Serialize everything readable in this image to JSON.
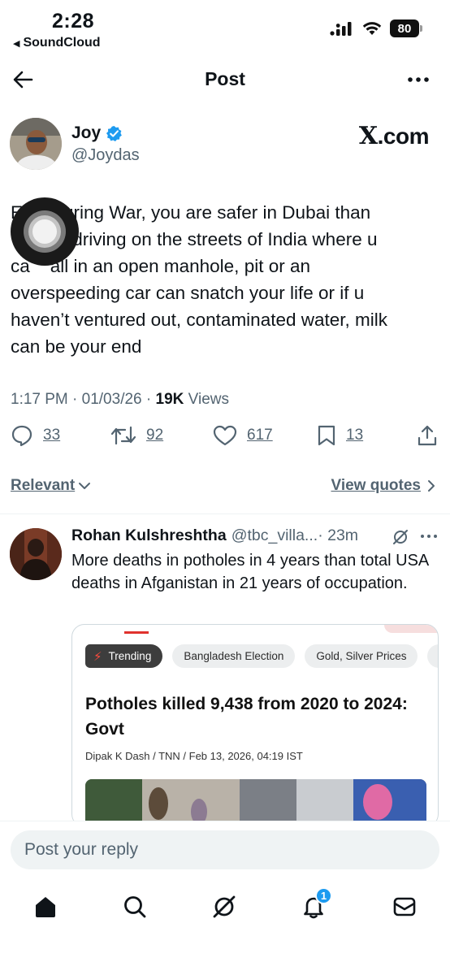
{
  "status_bar": {
    "time": "2:28",
    "back_app": "SoundCloud",
    "battery": "80"
  },
  "header": {
    "title": "Post"
  },
  "post": {
    "author_name": "Joy",
    "author_handle": "@Joydas",
    "source_logo_x": "X",
    "source_logo_text": ".com",
    "text": "Even during War, you are safer in Dubai than flying or driving on the streets of India where u can fall in an open manhole, pit or an overspeeding car can snatch your life or if u haven’t ventured out, contaminated water, milk can be your end",
    "text_visible_lines": [
      "E        uring War, you are safer in Dubai than",
      "        or driving on the streets of India where u",
      "ca    all in an open manhole, pit or an",
      "overspeeding car can snatch your life or if u",
      "haven’t ventured out, contaminated water, milk",
      "can be your end"
    ],
    "timestamp": "1:17 PM · 01/03/26 · ",
    "views_count": "19K",
    "views_label": " Views",
    "replies": "33",
    "reposts": "92",
    "likes": "617",
    "bookmarks": "13"
  },
  "filters": {
    "relevant_label": "Relevant",
    "view_quotes_label": "View quotes"
  },
  "reply": {
    "name": "Rohan Kulshreshtha",
    "handle": "@tbc_villa...",
    "time": " · 23m",
    "text": "More deaths in potholes in 4 years than total USA deaths in Afganistan in 21 years of occupation.",
    "card": {
      "chips": [
        "Trending",
        "Bangladesh Election",
        "Gold, Silver Prices"
      ],
      "headline": "Potholes killed 9,438 from 2020 to 2024: Govt",
      "byline": "Dipak K Dash / TNN / Feb 13, 2026, 04:19 IST"
    }
  },
  "composer": {
    "placeholder": "Post your reply"
  },
  "tabbar": {
    "notifications_badge": "1",
    "items": [
      "home-icon",
      "search-icon",
      "grok-icon",
      "notifications-icon",
      "messages-icon"
    ]
  },
  "colors": {
    "text": "#0f1419",
    "secondary": "#536471",
    "verified": "#1d9bf0",
    "divider": "#eff3f4"
  }
}
